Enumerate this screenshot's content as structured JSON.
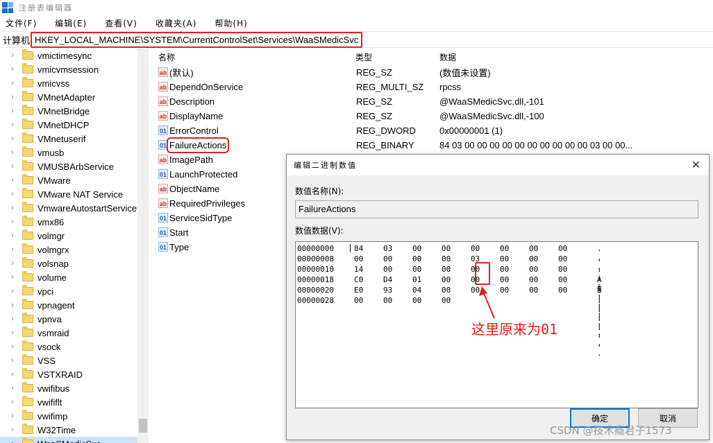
{
  "window": {
    "title": "注册表编辑器"
  },
  "menu": [
    "文件(F)",
    "编辑(E)",
    "查看(V)",
    "收藏夹(A)",
    "帮助(H)"
  ],
  "address": {
    "label": "计算机",
    "path": "HKEY_LOCAL_MACHINE\\SYSTEM\\CurrentControlSet\\Services\\WaaSMedicSvc"
  },
  "tree": {
    "items": [
      "vmictimesync",
      "vmicvmsession",
      "vmicvss",
      "VMnetAdapter",
      "VMnetBridge",
      "VMnetDHCP",
      "VMnetuserif",
      "vmusb",
      "VMUSBArbService",
      "VMware",
      "VMware NAT Service",
      "VmwareAutostartService",
      "vmx86",
      "volmgr",
      "volmgrx",
      "volsnap",
      "volume",
      "vpci",
      "vpnagent",
      "vpnva",
      "vsmraid",
      "vsock",
      "VSS",
      "VSTXRAID",
      "vwifibus",
      "vwififlt",
      "vwifimp",
      "W32Time",
      "WaaSMedicSvc"
    ]
  },
  "list": {
    "headers": {
      "name": "名称",
      "type": "类型",
      "data": "数据"
    },
    "rows": [
      {
        "icon": "ab",
        "name": "(默认)",
        "type": "REG_SZ",
        "data": "(数值未设置)"
      },
      {
        "icon": "ab",
        "name": "DependOnService",
        "type": "REG_MULTI_SZ",
        "data": "rpcss"
      },
      {
        "icon": "ab",
        "name": "Description",
        "type": "REG_SZ",
        "data": "@WaaSMedicSvc.dll,-101"
      },
      {
        "icon": "ab",
        "name": "DisplayName",
        "type": "REG_SZ",
        "data": "@WaaSMedicSvc.dll,-100"
      },
      {
        "icon": "bin",
        "name": "ErrorControl",
        "type": "REG_DWORD",
        "data": "0x00000001 (1)"
      },
      {
        "icon": "bin",
        "name": "FailureActions",
        "type": "REG_BINARY",
        "data": "84 03 00 00 00 00 00 00 00 00 00 00 03 00 00..."
      },
      {
        "icon": "ab",
        "name": "ImagePath",
        "type": "",
        "data": ""
      },
      {
        "icon": "bin",
        "name": "LaunchProtected",
        "type": "",
        "data": ""
      },
      {
        "icon": "ab",
        "name": "ObjectName",
        "type": "",
        "data": ""
      },
      {
        "icon": "ab",
        "name": "RequiredPrivileges",
        "type": "",
        "data": ""
      },
      {
        "icon": "bin",
        "name": "ServiceSidType",
        "type": "",
        "data": ""
      },
      {
        "icon": "bin",
        "name": "Start",
        "type": "",
        "data": ""
      },
      {
        "icon": "bin",
        "name": "Type",
        "type": "",
        "data": ""
      }
    ]
  },
  "dialog": {
    "title": "编辑二进制数值",
    "name_label": "数值名称(N):",
    "name_value": "FailureActions",
    "data_label": "数值数据(V):",
    "hex_rows": [
      {
        "offset": "00000000",
        "bytes": [
          "84",
          "03",
          "00",
          "00",
          "00",
          "00",
          "00",
          "00"
        ],
        "ascii": ". . . . . . . ."
      },
      {
        "offset": "00000008",
        "bytes": [
          "00",
          "00",
          "00",
          "00",
          "03",
          "00",
          "00",
          "00"
        ],
        "ascii": ". . . . . . . ."
      },
      {
        "offset": "00000010",
        "bytes": [
          "14",
          "00",
          "00",
          "00",
          "00",
          "00",
          "00",
          "00"
        ],
        "ascii": ". . . . . . . ."
      },
      {
        "offset": "00000018",
        "bytes": [
          "C0",
          "D4",
          "01",
          "00",
          "00",
          "00",
          "00",
          "00"
        ],
        "ascii": "À Ô . . . . . ."
      },
      {
        "offset": "00000020",
        "bytes": [
          "E0",
          "93",
          "04",
          "00",
          "00",
          "00",
          "00",
          "00"
        ],
        "ascii": "à . . . . . . ."
      },
      {
        "offset": "00000028",
        "bytes": [
          "00",
          "00",
          "00",
          "00"
        ],
        "ascii": ". . . ."
      }
    ],
    "annotation": "这里原来为01",
    "ok_label": "确定",
    "cancel_label": "取消"
  },
  "watermark": "CSDN @技术瘾君子1573",
  "colors": {
    "highlight_red": "#e0201a",
    "accent_blue": "#0078d7"
  }
}
